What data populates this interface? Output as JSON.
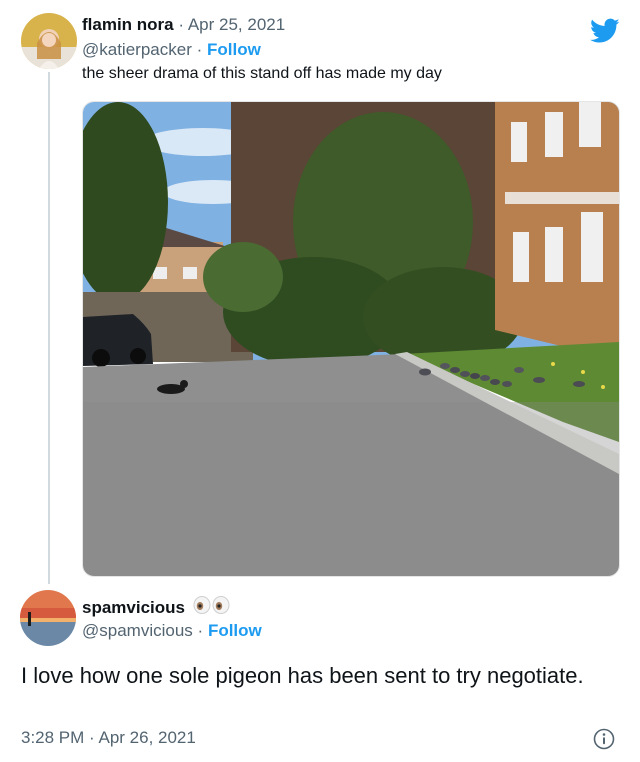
{
  "tweet": {
    "display_name": "flamin nora",
    "date": "Apr 25, 2021",
    "handle": "@katierpacker",
    "follow": "Follow",
    "text": "the sheer drama of this stand off has made my day",
    "logo_icon": "twitter-bird-icon",
    "brand_color": "#1d9bf0"
  },
  "reply": {
    "display_name": "spamvicious",
    "emoji_icon": "eyes-icon",
    "handle": "@spamvicious",
    "follow": "Follow",
    "text": "I love how one sole pigeon has been sent to try negotiate.",
    "timestamp": "3:28 PM · Apr 26, 2021",
    "info_icon": "info-icon"
  },
  "separator": "·"
}
